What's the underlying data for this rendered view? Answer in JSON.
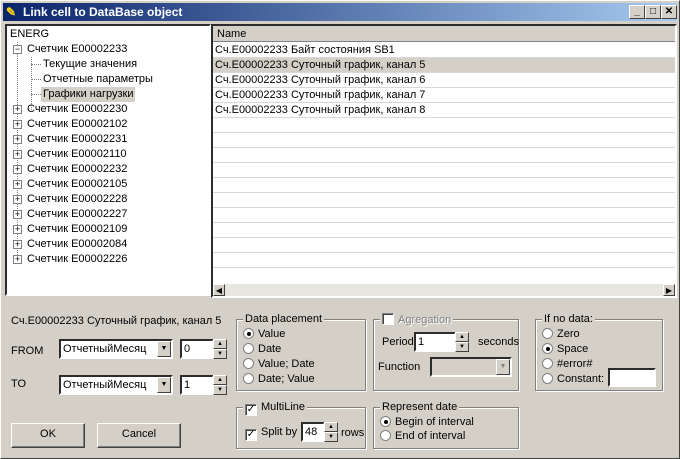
{
  "window": {
    "title": "Link cell to DataBase object",
    "min": "_",
    "max": "□",
    "close": "✕"
  },
  "tree": {
    "root": "ENERG",
    "expanded": "Счетчик E00002233",
    "children": [
      "Текущие значения",
      "Отчетные параметры",
      "Графики нагрузки"
    ],
    "items": [
      "Счетчик E00002230",
      "Счетчик E00002102",
      "Счетчик E00002231",
      "Счетчик E00002110",
      "Счетчик E00002232",
      "Счетчик E00002105",
      "Счетчик E00002228",
      "Счетчик E00002227",
      "Счетчик E00002109",
      "Счетчик E00002084",
      "Счетчик E00002226"
    ]
  },
  "list": {
    "header": "Name",
    "rows": [
      "Сч.E00002233 Байт состояния SB1",
      "Сч.E00002233 Суточный график, канал 5",
      "Сч.E00002233 Суточный график, канал 6",
      "Сч.E00002233 Суточный график, канал 7",
      "Сч.E00002233 Суточный график, канал 8"
    ],
    "selected_index": 1
  },
  "selection_label": "Сч.E00002233 Суточный график, канал 5",
  "from": {
    "label": "FROM",
    "combo": "ОтчетныйМесяц",
    "value": "0"
  },
  "to": {
    "label": "TO",
    "combo": "ОтчетныйМесяц",
    "value": "1"
  },
  "data_placement": {
    "title": "Data placement",
    "options": [
      "Value",
      "Date",
      "Value; Date",
      "Date; Value"
    ],
    "selected": 0
  },
  "aggregation": {
    "title": "Agregation",
    "period_label": "Period",
    "period_value": "1",
    "seconds": "seconds",
    "function_label": "Function",
    "function_value": ""
  },
  "no_data": {
    "title": "If no data:",
    "options": [
      "Zero",
      "Space",
      "#error#",
      "Constant:"
    ],
    "selected": 1,
    "constant_value": ""
  },
  "multiline": {
    "label": "MultiLine",
    "checked": true,
    "split_label": "Split by",
    "split_checked": true,
    "split_value": "48",
    "rows_label": "rows"
  },
  "represent_date": {
    "title": "Represent date",
    "options": [
      "Begin of interval",
      "End of interval"
    ],
    "selected": 0
  },
  "buttons": {
    "ok": "OK",
    "cancel": "Cancel"
  },
  "colors": {
    "selected_row": "#d4d0c8",
    "title_start": "#0a246a",
    "title_end": "#a6caf0"
  }
}
